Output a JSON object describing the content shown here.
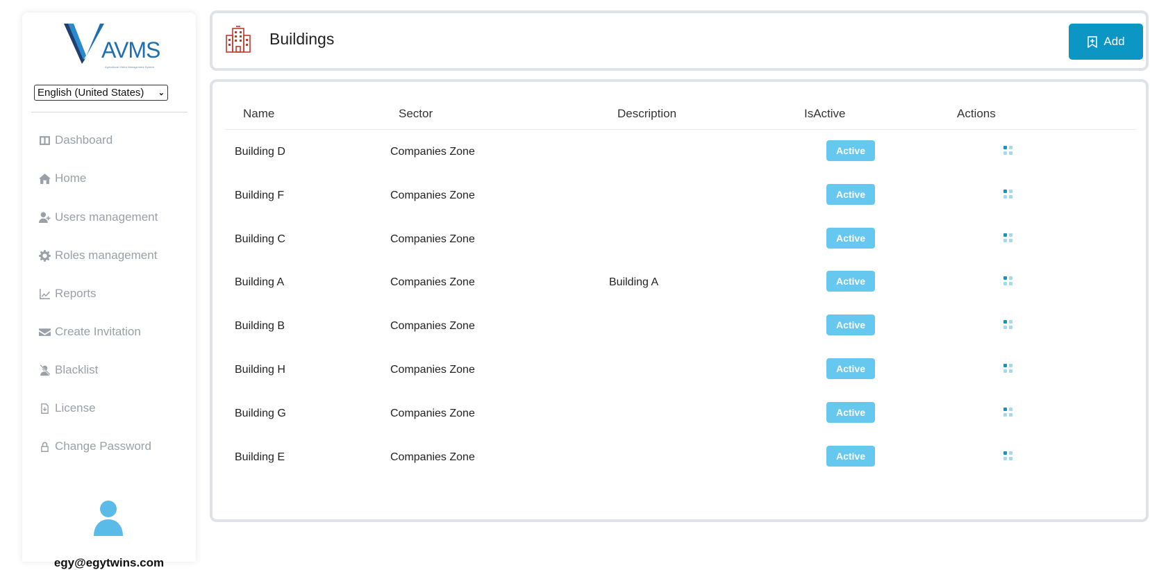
{
  "logo": {
    "text": "AVMS",
    "tagline": "Agricultural Visitor Management System"
  },
  "language": {
    "selected": "English (United States)"
  },
  "sidebar": {
    "items": [
      {
        "label": "Dashboard",
        "icon": "dashboard-icon"
      },
      {
        "label": "Home",
        "icon": "home-icon"
      },
      {
        "label": "Users management",
        "icon": "user-plus-icon"
      },
      {
        "label": "Roles management",
        "icon": "gear-icon"
      },
      {
        "label": "Reports",
        "icon": "chart-line-icon"
      },
      {
        "label": "Create Invitation",
        "icon": "envelope-icon"
      },
      {
        "label": "Blacklist",
        "icon": "user-slash-icon"
      },
      {
        "label": "License",
        "icon": "file-download-icon"
      },
      {
        "label": "Change Password",
        "icon": "lock-icon"
      }
    ]
  },
  "user": {
    "email": "egy@egytwins.com"
  },
  "header": {
    "title": "Buildings",
    "add_label": "Add"
  },
  "table": {
    "columns": [
      "Name",
      "Sector",
      "Description",
      "IsActive",
      "Actions"
    ],
    "rows": [
      {
        "name": "Building D",
        "sector": "Companies Zone",
        "description": "",
        "status": "Active"
      },
      {
        "name": "Building F",
        "sector": "Companies Zone",
        "description": "",
        "status": "Active"
      },
      {
        "name": "Building C",
        "sector": "Companies Zone",
        "description": "",
        "status": "Active"
      },
      {
        "name": "Building A",
        "sector": "Companies Zone",
        "description": "Building A",
        "status": "Active"
      },
      {
        "name": "Building B",
        "sector": "Companies Zone",
        "description": "",
        "status": "Active"
      },
      {
        "name": "Building H",
        "sector": "Companies Zone",
        "description": "",
        "status": "Active"
      },
      {
        "name": "Building G",
        "sector": "Companies Zone",
        "description": "",
        "status": "Active"
      },
      {
        "name": "Building E",
        "sector": "Companies Zone",
        "description": "",
        "status": "Active"
      }
    ]
  },
  "colors": {
    "accent": "#0b96c4",
    "badge": "#66c8ee",
    "building_icon": "#c0392b"
  }
}
